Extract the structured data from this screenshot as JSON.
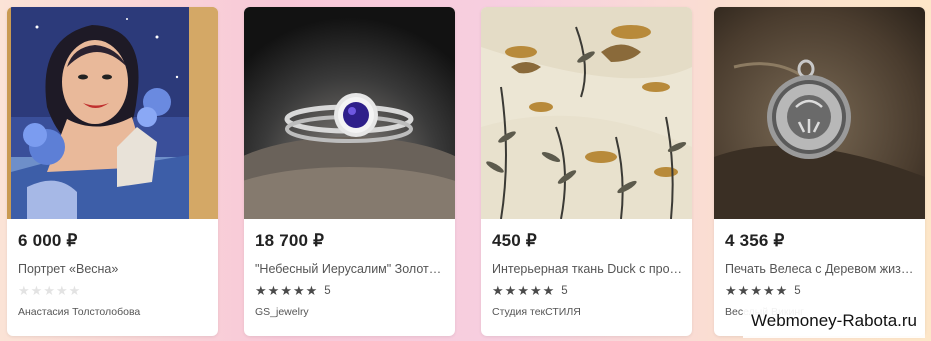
{
  "products": [
    {
      "price": "6 000 ₽",
      "title": "Портрет «Весна»",
      "rating_filled": 0,
      "rating_count": "",
      "seller": "Анастасия Толстолобова",
      "image": "painted-portrait-of-woman-with-blue-flowers"
    },
    {
      "price": "18 700 ₽",
      "title": "\"Небесный Иерусалим\" Золот…",
      "rating_filled": 5,
      "rating_count": "5",
      "seller": "GS_jewelry",
      "image": "ring-with-blue-sapphire"
    },
    {
      "price": "450 ₽",
      "title": "Интерьерная ткань Duck с про…",
      "rating_filled": 5,
      "rating_count": "5",
      "seller": "Студия текСТИЛЯ",
      "image": "floral-fabric-with-ducks"
    },
    {
      "price": "4 356 ₽",
      "title": "Печать Велеса с Деревом жиз…",
      "rating_filled": 5,
      "rating_count": "5",
      "seller": "Веселый Викинг",
      "image": "silver-amulet-pendant"
    }
  ],
  "watermark": "Webmoney-Rabota.ru",
  "colors": {
    "star_filled": "#4a4a4a",
    "star_empty": "#e3e3e3",
    "price_text": "#222222"
  }
}
